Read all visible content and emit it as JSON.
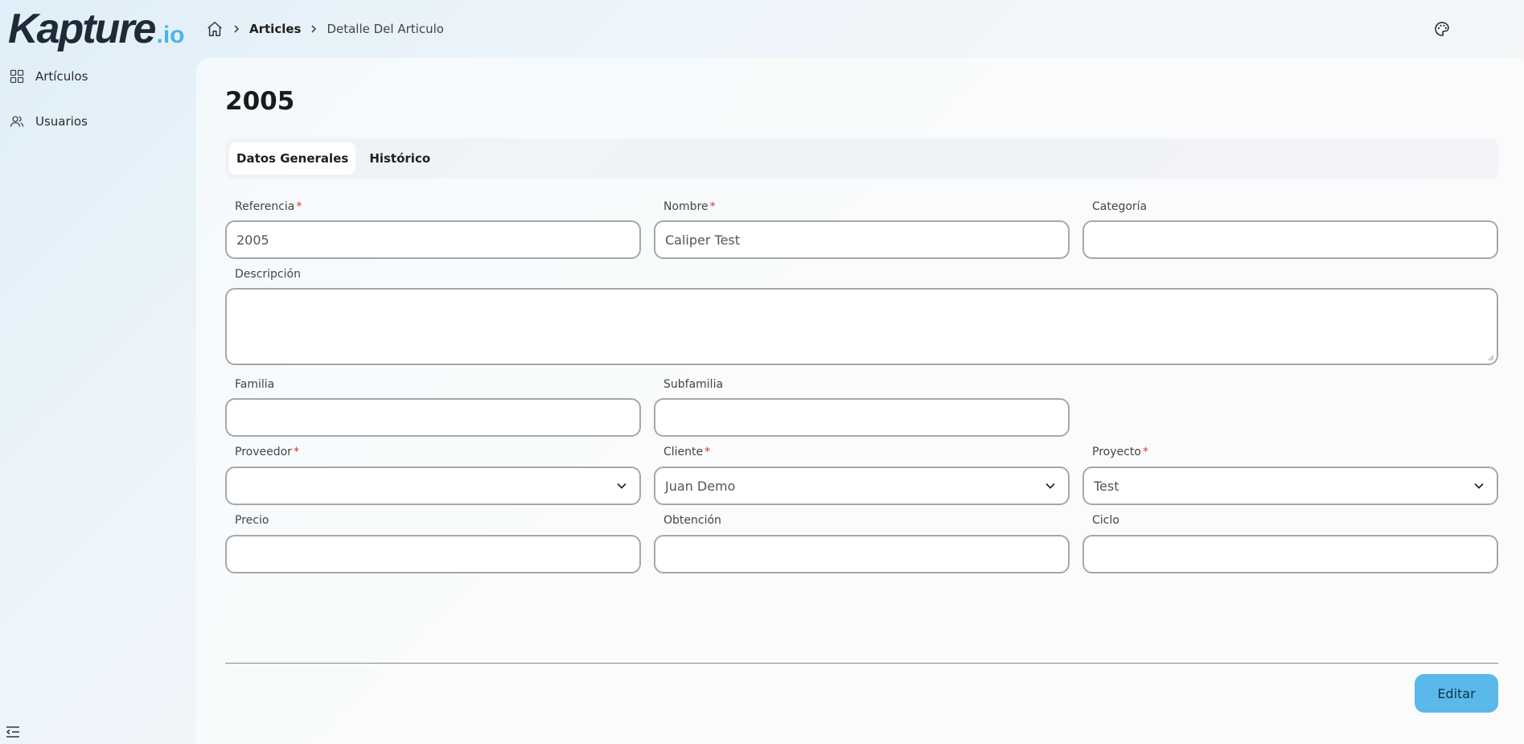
{
  "brand": {
    "logo_main": "Kapture",
    "logo_suffix": ".io",
    "accent": "#4ab4e8"
  },
  "breadcrumb": {
    "items": [
      "Articles",
      "Detalle Del Articulo"
    ]
  },
  "sidebar": {
    "items": [
      {
        "label": "Artículos",
        "icon": "grid-icon"
      },
      {
        "label": "Usuarios",
        "icon": "users-icon"
      }
    ]
  },
  "page": {
    "title": "2005"
  },
  "tabs": [
    {
      "label": "Datos Generales",
      "active": true
    },
    {
      "label": "Histórico",
      "active": false
    }
  ],
  "form": {
    "referencia": {
      "label": "Referencia",
      "required": "*",
      "value": "2005"
    },
    "nombre": {
      "label": "Nombre",
      "required": "*",
      "value": "Caliper Test"
    },
    "categoria": {
      "label": "Categoría",
      "value": ""
    },
    "descripcion": {
      "label": "Descripción",
      "value": ""
    },
    "familia": {
      "label": "Familia",
      "value": ""
    },
    "subfamilia": {
      "label": "Subfamilia",
      "value": ""
    },
    "proveedor": {
      "label": "Proveedor",
      "required": "*",
      "value": ""
    },
    "cliente": {
      "label": "Cliente",
      "required": "*",
      "value": "Juan Demo"
    },
    "proyecto": {
      "label": "Proyecto",
      "required": "*",
      "value": "Test"
    },
    "precio": {
      "label": "Precio",
      "value": ""
    },
    "obtencion": {
      "label": "Obtención",
      "value": ""
    },
    "ciclo": {
      "label": "Ciclo",
      "value": ""
    }
  },
  "actions": {
    "edit_label": "Editar",
    "edit_color": "#5ab8ea"
  }
}
